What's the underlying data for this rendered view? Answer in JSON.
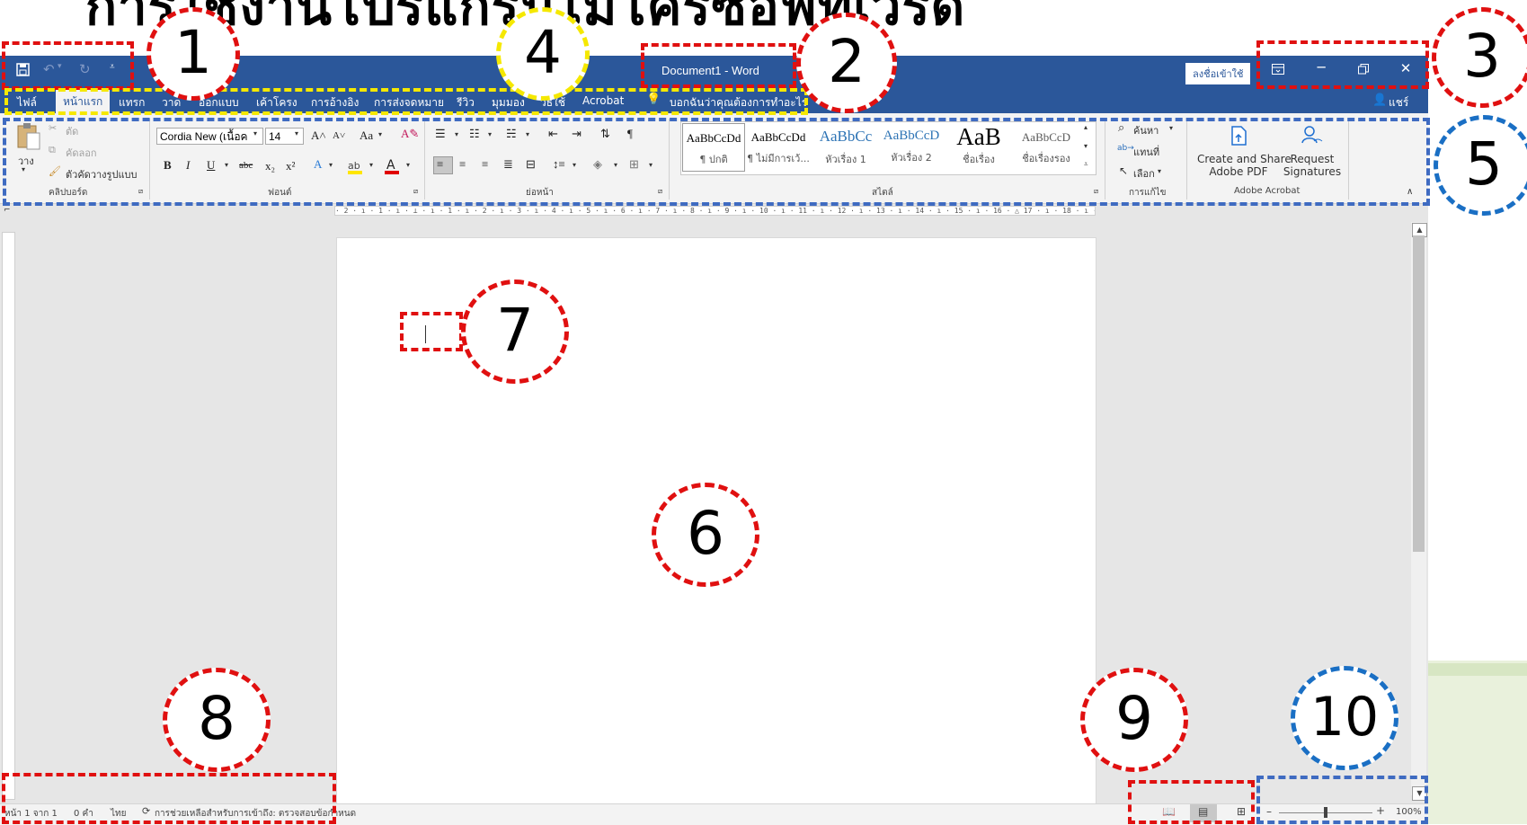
{
  "heading": "การใช้งานโปรแกรมไมโครซอฟท์เวิร์ด",
  "window": {
    "title": "Document1  -  Word",
    "signin_label": "ลงชื่อเข้าใช้",
    "share_label": "แชร์"
  },
  "quick_access": {
    "save_icon": "save-icon",
    "undo_icon": "undo-icon",
    "redo_icon": "redo-icon",
    "customize_icon": "customize-icon"
  },
  "tabs": [
    {
      "label": "ไฟล์"
    },
    {
      "label": "หน้าแรก",
      "active": true
    },
    {
      "label": "แทรก"
    },
    {
      "label": "วาด"
    },
    {
      "label": "ออกแบบ"
    },
    {
      "label": "เค้าโครง"
    },
    {
      "label": "การอ้างอิง"
    },
    {
      "label": "การส่งจดหมาย"
    },
    {
      "label": "รีวิว"
    },
    {
      "label": "มุมมอง"
    },
    {
      "label": "วิธีใช้"
    },
    {
      "label": "Acrobat"
    },
    {
      "label": "บอกฉันว่าคุณต้องการทำอะไร"
    }
  ],
  "ribbon": {
    "clipboard": {
      "paste": "วาง",
      "cut": "ตัด",
      "copy": "คัดลอก",
      "format_painter": "ตัวคัดวางรูปแบบ",
      "group": "คลิปบอร์ด"
    },
    "font": {
      "font_name": "Cordia New (เนื้อค",
      "font_size": "14",
      "grow": "A˄",
      "shrink": "A˅",
      "case": "Aa",
      "group": "ฟอนต์"
    },
    "paragraph": {
      "group": "ย่อหน้า"
    },
    "styles": {
      "items": [
        {
          "sample": "AaBbCcDd",
          "name": "¶ ปกติ"
        },
        {
          "sample": "AaBbCcDd",
          "name": "¶ ไม่มีการเว้..."
        },
        {
          "sample": "AaBbCc",
          "name": "หัวเรื่อง 1"
        },
        {
          "sample": "AaBbCcD",
          "name": "หัวเรื่อง 2"
        },
        {
          "sample": "AaB",
          "name": "ชื่อเรื่อง"
        },
        {
          "sample": "AaBbCcD",
          "name": "ชื่อเรื่องรอง"
        }
      ],
      "group": "สไตล์"
    },
    "editing": {
      "find": "ค้นหา",
      "replace": "แทนที่",
      "select": "เลือก",
      "group": "การแก้ไข"
    },
    "acrobat": {
      "create_share": "Create and Share Adobe PDF",
      "create_share_line1": "Create and Share",
      "create_share_line2": "Adobe PDF",
      "request_sig_line1": "Request",
      "request_sig_line2": "Signatures",
      "group": "Adobe Acrobat"
    }
  },
  "ruler": {
    "h_marks": "· 2 · ı · 1 · ı · ⊥ · ı · 1 · ı · 2 · ı · 3 · ı · 4 · ı · 5 · ı · 6 · ı · 7 · ı · 8 · ı · 9 · ı · 10 · ı · 11 · ı · 12 · ı · 13 · ı · 14 · ı · 15 · ı · 16 · △ 17 · ı · 18 · ı · 19"
  },
  "status": {
    "page": "หน้า 1 จาก 1",
    "words": "0 คำ",
    "language": "ไทย",
    "accessibility": "การช่วยเหลือสำหรับการเข้าถึง: ตรวจสอบข้อกำหนด",
    "zoom": "100%",
    "zoom_level": 1.0
  },
  "annotations": [
    "1",
    "2",
    "3",
    "4",
    "5",
    "6",
    "7",
    "8",
    "9",
    "10"
  ],
  "colors": {
    "word_blue": "#2b579a",
    "annotation_red": "#e01010",
    "annotation_blue": "#3f6bc1",
    "annotation_yellow": "#f5e800"
  }
}
